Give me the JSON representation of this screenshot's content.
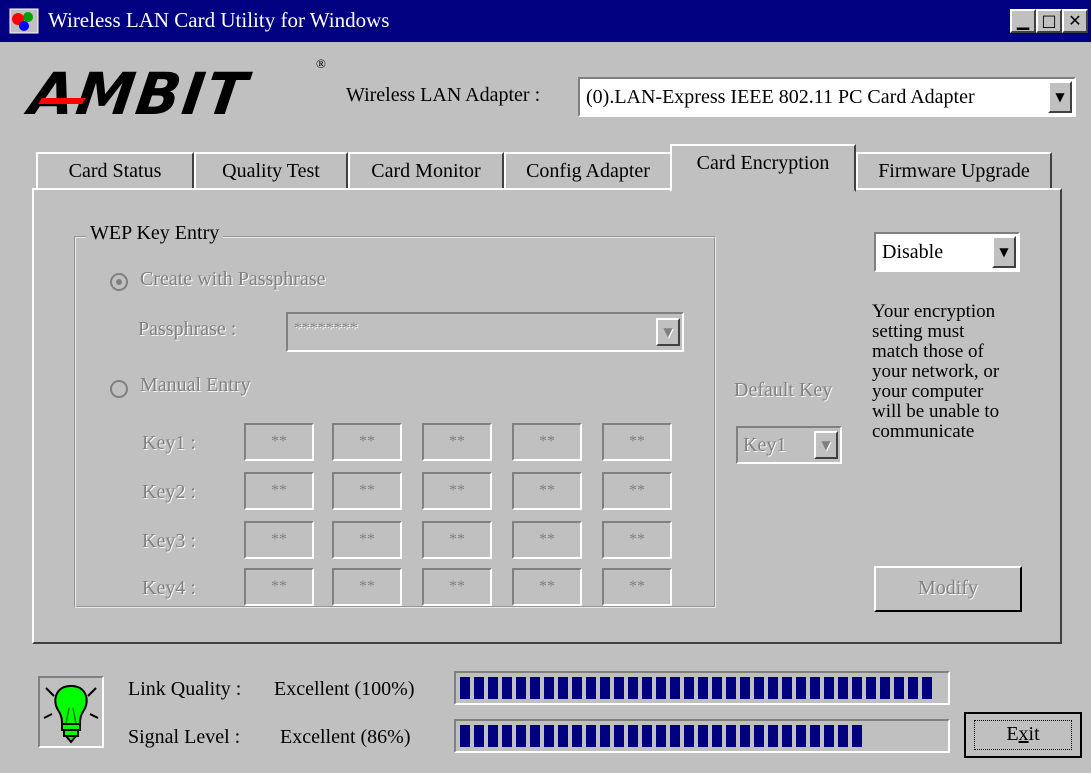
{
  "window": {
    "title": "Wireless LAN Card Utility for Windows"
  },
  "brand": {
    "logo_text": "AMBIT",
    "registered_mark": "®"
  },
  "adapter": {
    "label": "Wireless LAN Adapter :",
    "selected": "(0).LAN-Express IEEE 802.11 PC Card Adapter"
  },
  "tabs": [
    {
      "label": "Card Status"
    },
    {
      "label": "Quality Test"
    },
    {
      "label": "Card Monitor"
    },
    {
      "label": "Config Adapter"
    },
    {
      "label": "Card Encryption",
      "active": true
    },
    {
      "label": "Firmware Upgrade"
    }
  ],
  "wep": {
    "group_title": "WEP Key Entry",
    "passphrase_option": "Create with Passphrase",
    "passphrase_label": "Passphrase :",
    "passphrase_value": "********",
    "manual_option": "Manual Entry",
    "keys": [
      {
        "label": "Key1 :",
        "values": [
          "**",
          "**",
          "**",
          "**",
          "**"
        ]
      },
      {
        "label": "Key2 :",
        "values": [
          "**",
          "**",
          "**",
          "**",
          "**"
        ]
      },
      {
        "label": "Key3 :",
        "values": [
          "**",
          "**",
          "**",
          "**",
          "**"
        ]
      },
      {
        "label": "Key4 :",
        "values": [
          "**",
          "**",
          "**",
          "**",
          "**"
        ]
      }
    ]
  },
  "encryption": {
    "mode": "Disable",
    "note_lines": [
      "Your encryption",
      "setting must",
      "match those of",
      "your network, or",
      "your computer",
      "will be unable to",
      "communicate"
    ],
    "default_key_label": "Default Key",
    "default_key_value": "Key1",
    "modify_label": "Modify"
  },
  "status": {
    "link_quality_label": "Link Quality :",
    "link_quality_value": "Excellent (100%)",
    "link_quality_percent": 100,
    "signal_level_label": "Signal Level :",
    "signal_level_value": "Excellent (86%)",
    "signal_level_percent": 86,
    "exit_label": "Exit",
    "exit_mnemonic": "x"
  },
  "icons": {
    "app": "wireless-app-icon",
    "status": "lightbulb-icon",
    "dropdown": "triangle-down-icon"
  },
  "colors": {
    "titlebar": "#000080",
    "meter_fill": "#000080",
    "face": "#c0c0c0",
    "bulb": "#00ff00"
  }
}
